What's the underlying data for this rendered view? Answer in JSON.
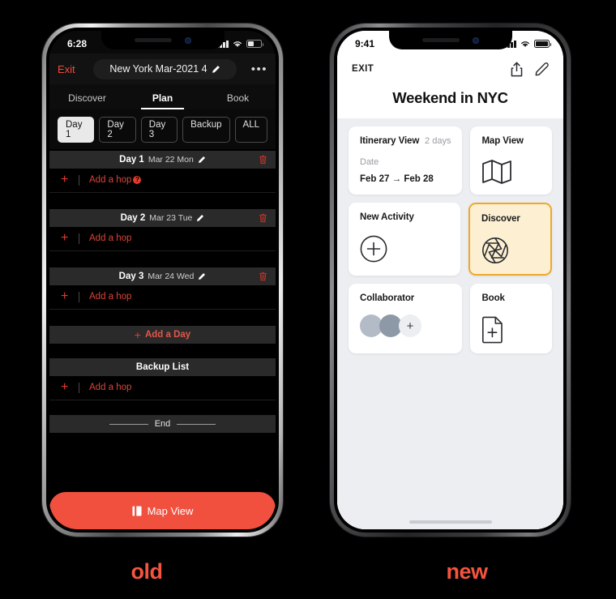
{
  "captions": {
    "old": "old",
    "new": "new"
  },
  "old_phone": {
    "status": {
      "time": "6:28",
      "signal": "cellular-signal",
      "wifi": "wifi",
      "battery": "battery"
    },
    "navbar": {
      "exit_label": "Exit",
      "trip_title": "New York Mar-2021 4",
      "edit_icon": "pencil-icon",
      "more_label": "•••"
    },
    "tabs": [
      {
        "label": "Discover",
        "active": false
      },
      {
        "label": "Plan",
        "active": true
      },
      {
        "label": "Book",
        "active": false
      }
    ],
    "chips": [
      {
        "label": "Day 1",
        "selected": true
      },
      {
        "label": "Day 2",
        "selected": false
      },
      {
        "label": "Day 3",
        "selected": false
      },
      {
        "label": "Backup",
        "selected": false
      },
      {
        "label": "ALL",
        "selected": false
      }
    ],
    "days": [
      {
        "title": "Day 1",
        "date": "Mar 22 Mon",
        "add_label": "Add a hop",
        "has_help": true
      },
      {
        "title": "Day 2",
        "date": "Mar 23 Tue",
        "add_label": "Add a hop",
        "has_help": false
      },
      {
        "title": "Day 3",
        "date": "Mar 24 Wed",
        "add_label": "Add a hop",
        "has_help": false
      }
    ],
    "add_day_label": "Add a Day",
    "backup": {
      "title": "Backup List",
      "add_label": "Add a hop"
    },
    "end_label": "End",
    "map_button_label": "Map View",
    "accent_color": "#f1503f"
  },
  "new_phone": {
    "status": {
      "time": "9:41",
      "signal": "cellular-signal",
      "wifi": "wifi",
      "battery": "battery"
    },
    "navbar": {
      "exit_label": "EXIT",
      "share_icon": "share-icon",
      "edit_icon": "pencil-icon"
    },
    "title": "Weekend in NYC",
    "cards": {
      "itinerary": {
        "title": "Itinerary View",
        "duration": "2 days",
        "date_label": "Date",
        "date_range": "Feb 27 → Feb 28"
      },
      "map": {
        "title": "Map View",
        "icon": "map-icon"
      },
      "new_activity": {
        "title": "New Activity",
        "icon": "plus-circle-icon"
      },
      "discover": {
        "title": "Discover",
        "icon": "aperture-icon",
        "selected": true,
        "highlight_color": "#efa829",
        "highlight_bg": "#fdf0d2"
      },
      "collaborator": {
        "title": "Collaborator",
        "avatars": 2,
        "add_icon": "plus-icon"
      },
      "book": {
        "title": "Book",
        "icon": "document-plus-icon"
      }
    },
    "home_indicator": "home-indicator"
  }
}
